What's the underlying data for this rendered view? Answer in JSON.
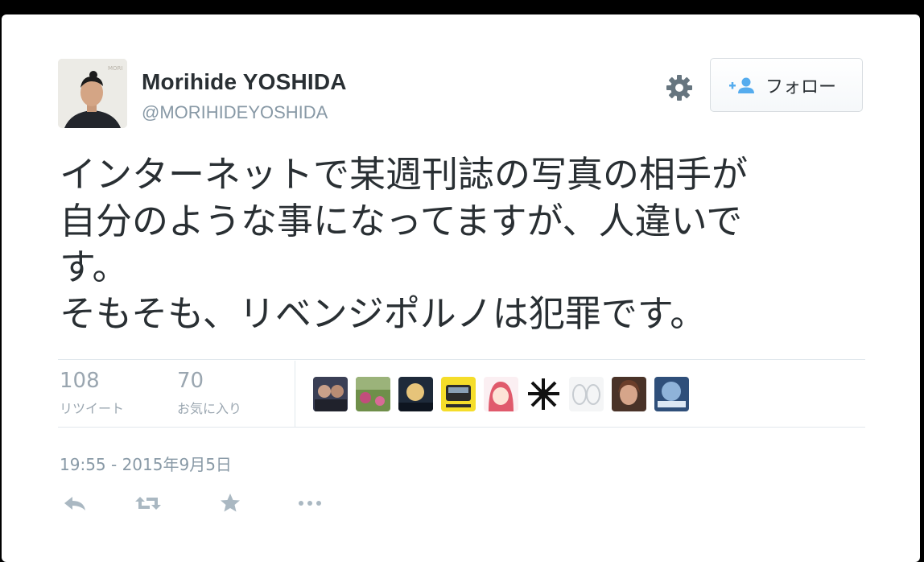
{
  "author": {
    "name": "Morihide YOSHIDA",
    "handle": "@MORIHIDEYOSHIDA",
    "avatar_icon": "user-avatar"
  },
  "header": {
    "settings_icon": "gear-icon",
    "follow_label": "フォロー",
    "follow_icon": "add-user-icon"
  },
  "tweet": {
    "lines": [
      "インターネットで某週刊誌の写真の相手が",
      "自分のような事になってますが、人違いで",
      "す。",
      "そもそも、リベンジポルノは犯罪です。"
    ]
  },
  "stats": {
    "retweets": {
      "count": "108",
      "label": "リツイート"
    },
    "favorites": {
      "count": "70",
      "label": "お気に入り"
    }
  },
  "timestamp": "19:55 - 2015年9月5日",
  "actions": [
    "reply-icon",
    "retweet-icon",
    "favorite-icon",
    "more-icon"
  ],
  "colors": {
    "text": "#292f33",
    "muted": "#8899a6",
    "accent": "#55acee",
    "divider": "#e1e8ed"
  }
}
